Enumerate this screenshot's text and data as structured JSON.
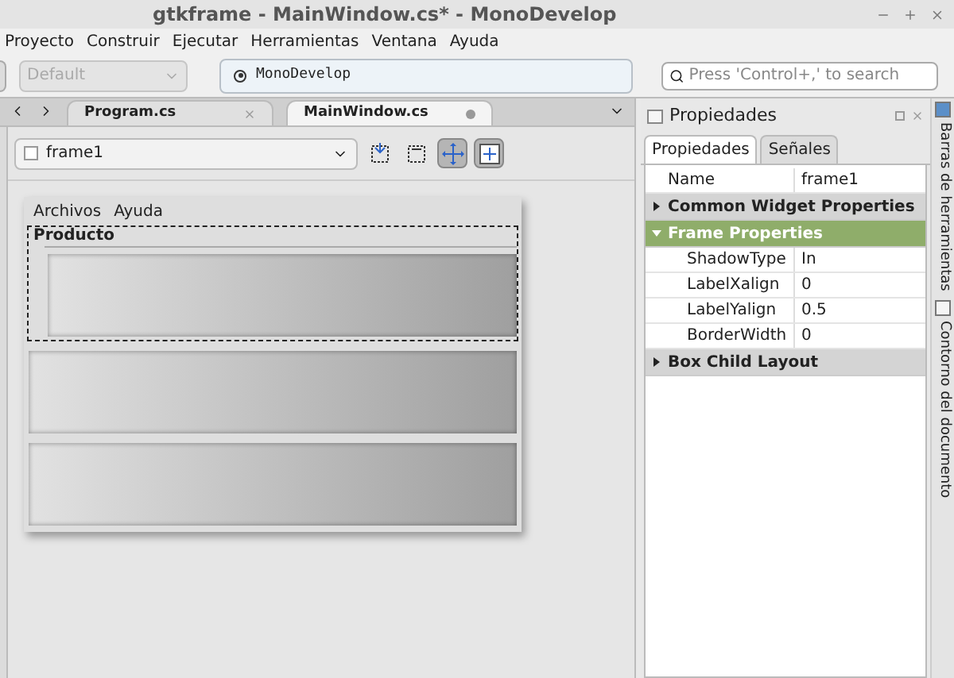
{
  "window": {
    "title": "gtkframe - MainWindow.cs* - MonoDevelop"
  },
  "menu": [
    "Proyecto",
    "Construir",
    "Ejecutar",
    "Herramientas",
    "Ventana",
    "Ayuda"
  ],
  "toolbar": {
    "configuration": {
      "value": "Default",
      "disabled": true
    },
    "status": "MonoDevelop",
    "search": {
      "placeholder": "Press 'Control+,' to search"
    }
  },
  "document_tabs": [
    {
      "label": "Program.cs",
      "selected": false,
      "modified": false
    },
    {
      "label": "MainWindow.cs",
      "selected": true,
      "modified": true
    }
  ],
  "designer": {
    "widget": "frame1",
    "tools": [
      {
        "selected": false
      },
      {
        "selected": false
      },
      {
        "selected": true
      },
      {
        "selected": true
      }
    ],
    "form": {
      "menu": [
        "Archivos",
        "Ayuda"
      ],
      "frame_label": "Producto",
      "panels": [
        {
          "in_frame": true
        },
        {
          "in_frame": false
        },
        {
          "in_frame": false
        }
      ]
    }
  },
  "properties": {
    "title": "Propiedades",
    "tabs": [
      {
        "label": "Propiedades",
        "selected": true
      },
      {
        "label": "Señales",
        "selected": false
      }
    ],
    "rows": [
      {
        "kind": "property",
        "name": "Name",
        "value": "frame1"
      },
      {
        "kind": "section",
        "name": "Common Widget Properties",
        "expanded": false,
        "selected": false
      },
      {
        "kind": "section",
        "name": "Frame Properties",
        "expanded": true,
        "selected": true,
        "children": [
          {
            "kind": "property",
            "name": "ShadowType",
            "value": "In"
          },
          {
            "kind": "property",
            "name": "LabelXalign",
            "value": "0"
          },
          {
            "kind": "property",
            "name": "LabelYalign",
            "value": "0.5"
          },
          {
            "kind": "property",
            "name": "BorderWidth",
            "value": "0"
          }
        ]
      },
      {
        "kind": "section",
        "name": "Box Child Layout",
        "expanded": false,
        "selected": false
      }
    ]
  },
  "side_tabs": [
    "Barras de herramientas",
    "Contorno del documento"
  ]
}
